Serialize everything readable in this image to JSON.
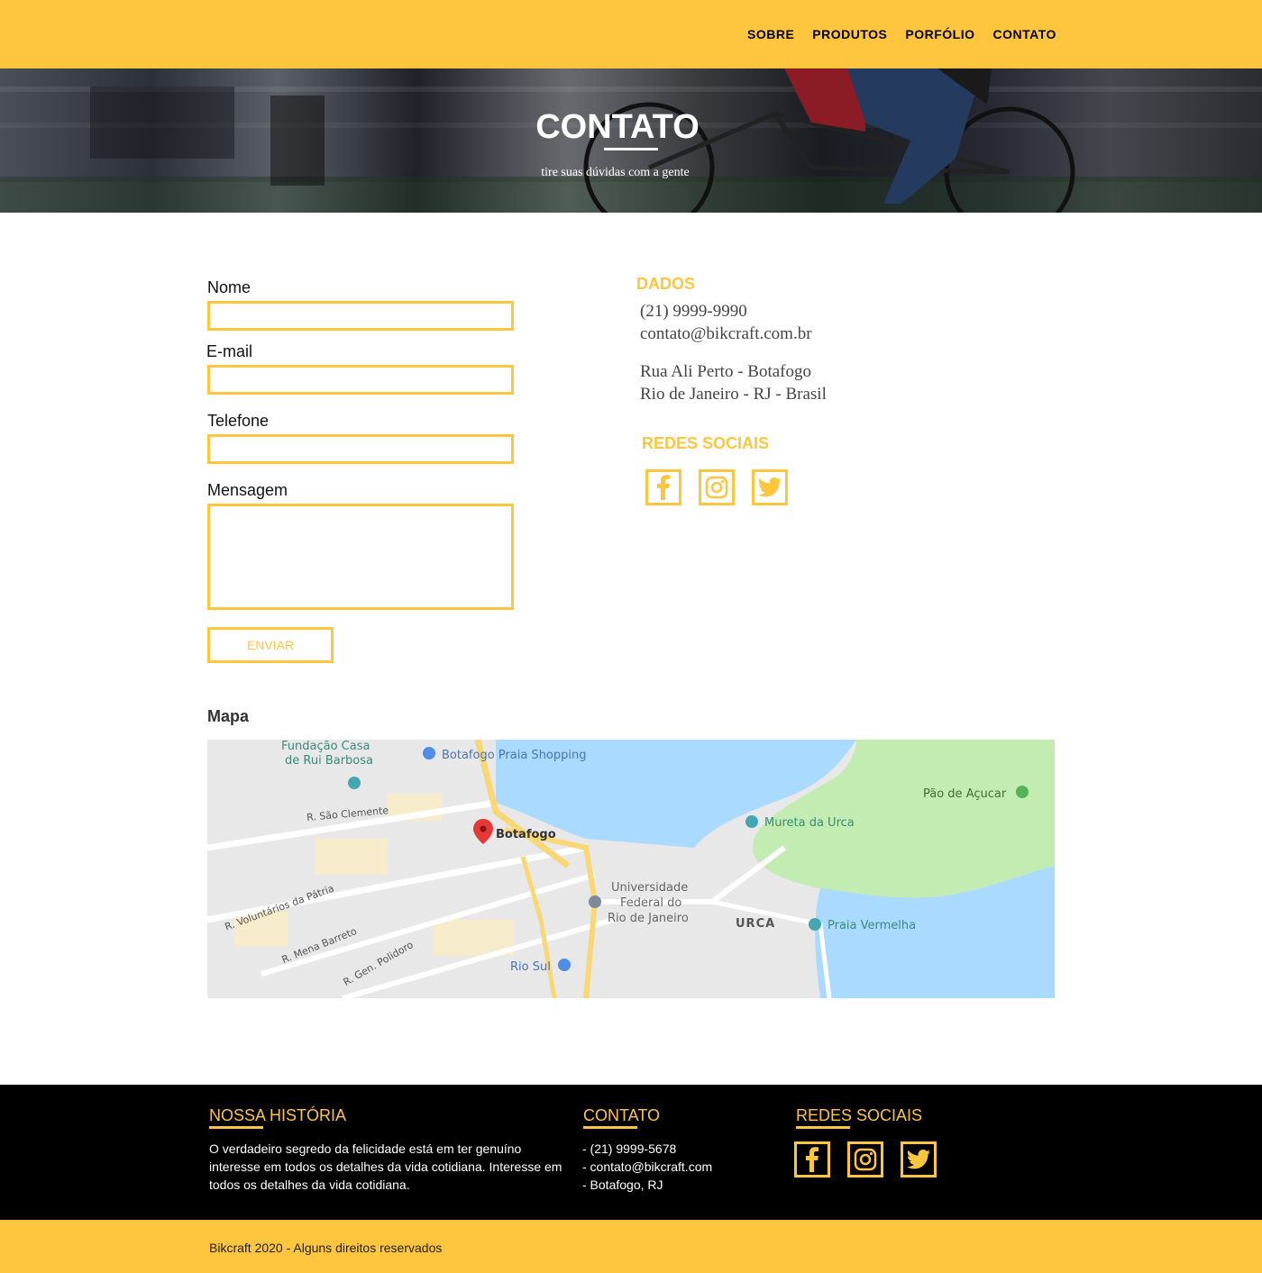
{
  "nav": {
    "items": [
      {
        "label": "SOBRE"
      },
      {
        "label": "PRODUTOS"
      },
      {
        "label": "PORFÓLIO"
      },
      {
        "label": "CONTATO"
      }
    ]
  },
  "hero": {
    "title": "CONTATO",
    "subtitle": "tire suas dúvidas com a gente"
  },
  "form": {
    "name_label": "Nome",
    "email_label": "E-mail",
    "phone_label": "Telefone",
    "message_label": "Mensagem",
    "name_value": "",
    "email_value": "",
    "phone_value": "",
    "message_value": "",
    "submit_label": "ENVIAR"
  },
  "dados": {
    "title": "DADOS",
    "phone": "(21) 9999-9990",
    "email": "contato@bikcraft.com.br",
    "address_line1": "Rua Ali Perto - Botafogo",
    "address_line2": "Rio de Janeiro - RJ - Brasil"
  },
  "social": {
    "title": "REDES SOCIAIS",
    "icons": [
      "facebook-icon",
      "instagram-icon",
      "twitter-icon"
    ]
  },
  "map": {
    "title": "Mapa",
    "labels": {
      "fundacao": "Fundação Casa",
      "fundacao2": "de Rui Barbosa",
      "shopping": "Botafogo Praia Shopping",
      "pao": "Pão de Açucar",
      "clemente": "R. São Clemente",
      "botafogo": "Botafogo",
      "mureta": "Mureta da Urca",
      "univ1": "Universidade",
      "univ2": "Federal do",
      "univ3": "Rio de Janeiro",
      "urca": "URCA",
      "praia": "Praia Vermelha",
      "voluntarios": "R. Voluntários da Pátria",
      "mena": "R. Mena Barreto",
      "polidoro": "R. Gen. Polidoro",
      "riosul": "Rio Sul"
    }
  },
  "footer": {
    "history_title": "NOSSA HISTÓRIA",
    "history_text": "O verdadeiro segredo da felicidade está em ter genuíno interesse em todos os detalhes da vida cotidiana. Interesse em todos os detalhes da vida cotidiana.",
    "contact_title": "CONTATO",
    "contact_phone": "- (21) 9999-5678",
    "contact_email": "- contato@bikcraft.com",
    "contact_address": "- Botafogo, RJ",
    "social_title": "REDES SOCIAIS",
    "copyright": "Bikcraft 2020 - Alguns direitos reservados"
  },
  "colors": {
    "accent": "#fec53f",
    "footer_bg": "#000000",
    "map_water": "#a9d4f5",
    "map_park": "#c2ecb1"
  }
}
